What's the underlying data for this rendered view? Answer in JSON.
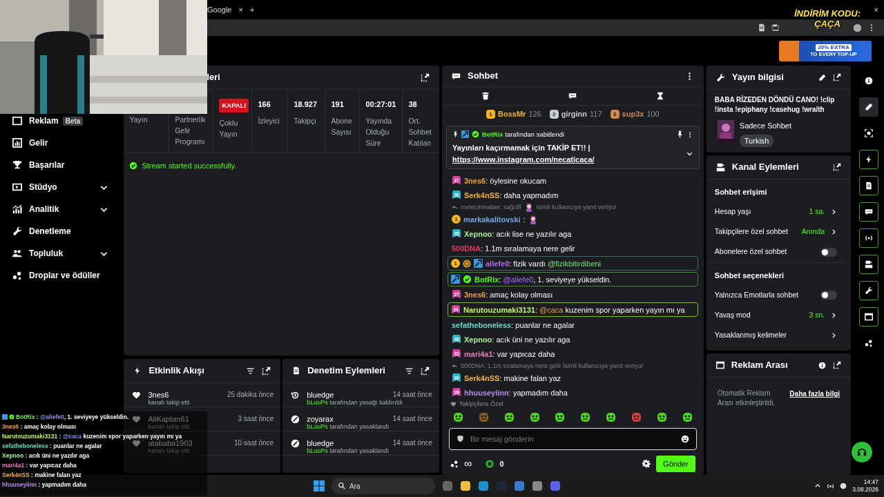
{
  "browser": {
    "tab_title": "Google",
    "tab_close": "×",
    "new_tab": "+",
    "window_close": "×"
  },
  "stream_overlay": {
    "promo_line1": "İNDİRİM KODU:",
    "promo_line2": "ÇAÇA"
  },
  "ad_banner": {
    "headline": "20% EXTRA",
    "subline": "TO EVERY TOP-UP"
  },
  "sidebar": {
    "items": [
      {
        "label": "Reklam",
        "badge": "Beta"
      },
      {
        "label": "Gelir"
      },
      {
        "label": "Başarılar"
      },
      {
        "label": "Stüdyo",
        "expanded": false
      },
      {
        "label": "Analitik",
        "expanded": false
      },
      {
        "label": "Denetleme"
      },
      {
        "label": "Topluluk",
        "expanded": false
      },
      {
        "label": "Droplar ve ödüller"
      }
    ]
  },
  "stats_panel": {
    "title": "leri",
    "stats": [
      {
        "label": "Yayın"
      },
      {
        "label": "Partnerlik Gelir Programı"
      },
      {
        "status": "KAPALI",
        "label": "Çoklu Yayın"
      },
      {
        "value": "166",
        "label": "İzleyici"
      },
      {
        "value": "18.927",
        "label": "Takipçi"
      },
      {
        "value": "191",
        "label": "Abone Sayısı"
      },
      {
        "value": "00:27:01",
        "label": "Yayında Olduğu Süre"
      },
      {
        "value": "38",
        "label": "Ort. Sohbet Katılan"
      }
    ],
    "notice": "Stream started successfully."
  },
  "activity_feed": {
    "title": "Etkinlik Akışı",
    "items": [
      {
        "user": "3nes6",
        "time": "25 dakika önce",
        "action": "kanalı takip etti"
      },
      {
        "user": "AliKaptan61",
        "time": "3 saat önce",
        "action": "kanalı takip etti"
      },
      {
        "user": "atababa1903",
        "time": "10 saat önce",
        "action": "kanalı takip etti"
      }
    ]
  },
  "mod_actions": {
    "title": "Denetim Eylemleri",
    "items": [
      {
        "kind": "unban",
        "user": "bluedge",
        "time": "14 saat önce",
        "moderator": "bLuuPs",
        "action": " tarafından yasağı kaldırıldı"
      },
      {
        "kind": "ban",
        "user": "zoyarax",
        "time": "14 saat önce",
        "moderator": "bLuuPs",
        "action": " tarafından yasaklandı"
      },
      {
        "kind": "ban",
        "user": "bluedge",
        "time": "14 saat önce",
        "moderator": "bLuuPs",
        "action": " tarafından yasaklandı"
      }
    ]
  },
  "chat": {
    "title": "Sohbet",
    "leaderboard": [
      {
        "rank": "1",
        "user": "BossMr",
        "score": "126",
        "color": "#f0b429"
      },
      {
        "rank": "2",
        "user": "girginn",
        "score": "117",
        "color": "#c9ccd1"
      },
      {
        "rank": "3",
        "user": "sup3x",
        "score": "100",
        "color": "#d08a4e"
      }
    ],
    "pinned": {
      "author": "BotRix",
      "note": " tarafından sabitlendi",
      "text": "Yayınları kaçırmamak için TAKİP ET!! |",
      "link": "https://www.instagram.com/necaticaca/"
    },
    "messages": [
      {
        "kind": "message",
        "badges": [
          {
            "kind": "sub",
            "text": "27",
            "color": "#d6409f"
          }
        ],
        "parts": [
          {
            "kind": "user",
            "text": "3nes6",
            "color": "#f0a040"
          },
          {
            "kind": "text",
            "text": ": öylesine okucam"
          }
        ]
      },
      {
        "kind": "message",
        "badges": [
          {
            "kind": "sub",
            "text": "30",
            "color": "#2bb5c8"
          }
        ],
        "parts": [
          {
            "kind": "user",
            "text": "Serk4nSS",
            "color": "#f5b041"
          },
          {
            "kind": "text",
            "text": ": daha yapmadım"
          }
        ]
      },
      {
        "kind": "reply",
        "parts": [
          {
            "kind": "text",
            "text": "metecimnaber: sağolll"
          },
          {
            "kind": "emote"
          },
          {
            "kind": "text",
            "text": "isimli kullanıcıya yanıt veriyor"
          }
        ]
      },
      {
        "kind": "message",
        "badges": [
          {
            "kind": "tier",
            "text": "1"
          }
        ],
        "parts": [
          {
            "kind": "user",
            "text": "markakalitovski",
            "color": "#7aa7e8"
          },
          {
            "kind": "text",
            "text": ":"
          },
          {
            "kind": "emote"
          }
        ]
      },
      {
        "kind": "message",
        "badges": [
          {
            "kind": "sub",
            "text": "35",
            "color": "#2bb5c8"
          }
        ],
        "parts": [
          {
            "kind": "user",
            "text": "Xepnoo",
            "color": "#a6f29a"
          },
          {
            "kind": "text",
            "text": ": acık lise ne yazılır aga"
          }
        ]
      },
      {
        "kind": "message",
        "parts": [
          {
            "kind": "user",
            "text": "500DNA",
            "color": "#e8365d"
          },
          {
            "kind": "text",
            "text": ": 1.1m sıralamaya nere gelir"
          }
        ]
      },
      {
        "kind": "message",
        "highlighted": true,
        "color": "#2f6f68",
        "badges": [
          {
            "kind": "tier",
            "text": "1"
          },
          {
            "kind": "coin"
          },
          {
            "kind": "moderator"
          }
        ],
        "parts": [
          {
            "kind": "user",
            "text": "aliefe0",
            "color": "#b06cf0"
          },
          {
            "kind": "text",
            "text": ": fizik vardı "
          },
          {
            "kind": "mention",
            "text": "@fizikbitirdibeni",
            "color": "#7be07b"
          }
        ]
      },
      {
        "kind": "message",
        "highlighted": true,
        "color": "#3f8f2f",
        "badges": [
          {
            "kind": "moderator"
          },
          {
            "kind": "verified"
          }
        ],
        "parts": [
          {
            "kind": "user",
            "text": "BotRix",
            "color": "#53fc18"
          },
          {
            "kind": "text",
            "text": ": "
          },
          {
            "kind": "mention",
            "text": "@aliefe0",
            "color": "#b06cf0"
          },
          {
            "kind": "text",
            "text": ", 1. seviyeye yükseldin."
          }
        ]
      },
      {
        "kind": "message",
        "badges": [
          {
            "kind": "sub",
            "text": "27",
            "color": "#d6409f"
          }
        ],
        "parts": [
          {
            "kind": "user",
            "text": "3nes6",
            "color": "#f0a040"
          },
          {
            "kind": "text",
            "text": ": amaç kolay olması"
          }
        ]
      },
      {
        "kind": "message",
        "highlighted": true,
        "color": "#6fbf3f",
        "badges": [
          {
            "kind": "sub",
            "text": "24",
            "color": "#d6409f"
          }
        ],
        "parts": [
          {
            "kind": "user",
            "text": "Narutouzumaki3131",
            "color": "#c8f56a"
          },
          {
            "kind": "text",
            "text": ": "
          },
          {
            "kind": "mention",
            "text": "@caca",
            "color": "#f0a040"
          },
          {
            "kind": "text",
            "text": " kuzenim spor yaparken yayın mı ya"
          }
        ]
      },
      {
        "kind": "message",
        "parts": [
          {
            "kind": "user",
            "text": "sefatheboneless",
            "color": "#6ad8c8"
          },
          {
            "kind": "text",
            "text": ": puanlar ne agalar"
          }
        ]
      },
      {
        "kind": "message",
        "badges": [
          {
            "kind": "sub",
            "text": "35",
            "color": "#2bb5c8"
          }
        ],
        "parts": [
          {
            "kind": "user",
            "text": "Xepnoo",
            "color": "#a6f29a"
          },
          {
            "kind": "text",
            "text": ": acık üni ne yazılır aga"
          }
        ]
      },
      {
        "kind": "message",
        "badges": [
          {
            "kind": "sub",
            "text": "22",
            "color": "#d6409f"
          }
        ],
        "parts": [
          {
            "kind": "user",
            "text": "mari4a1",
            "color": "#ea7fc0"
          },
          {
            "kind": "text",
            "text": ": var yapıcaz daha"
          }
        ]
      },
      {
        "kind": "reply",
        "parts": [
          {
            "kind": "text",
            "text": "500DNA: 1.1m sıralamaya nere gelir isimli kullanıcıya yanıt veriyor"
          }
        ]
      },
      {
        "kind": "message",
        "badges": [
          {
            "kind": "sub",
            "text": "30",
            "color": "#2bb5c8"
          }
        ],
        "parts": [
          {
            "kind": "user",
            "text": "Serk4nSS",
            "color": "#f5b041"
          },
          {
            "kind": "text",
            "text": ": makine falan yaz"
          }
        ]
      },
      {
        "kind": "message",
        "badges": [
          {
            "kind": "sub",
            "text": "29",
            "color": "#d6409f"
          }
        ],
        "parts": [
          {
            "kind": "user",
            "text": "hhuuseyiinn",
            "color": "#b98cf0"
          },
          {
            "kind": "text",
            "text": ": yapmadım daha"
          }
        ]
      }
    ],
    "followers_only_label": "Takipçilere Özel",
    "emotes": [
      {
        "color": "#53d42b"
      },
      {
        "color": "#8a5a2b"
      },
      {
        "color": "#53d42b"
      },
      {
        "color": "#53d42b"
      },
      {
        "color": "#53d42b"
      },
      {
        "color": "#53d42b"
      },
      {
        "color": "#53d42b"
      },
      {
        "color": "#d9423a"
      },
      {
        "color": "#53d42b"
      },
      {
        "color": "#53d42b"
      }
    ],
    "input": {
      "placeholder": "Bir mesaj gönderin"
    },
    "points": "∞",
    "coins": "0",
    "send_button": "Gönder"
  },
  "stream_info": {
    "title": "Yayın bilgisi",
    "stream_title": "BABA RİZEDEN DÖNDÜ CANO! !clip !insta !epiphany !casehug !wraith",
    "category": "Sadece Sohbet",
    "tag": "Turkish"
  },
  "channel_actions": {
    "title": "Kanal Eylemleri",
    "sections": [
      {
        "heading": "Sohbet erişimi",
        "rows": [
          {
            "kind": "link",
            "label": "Hesap yaşı",
            "value": "1 sa."
          },
          {
            "kind": "link",
            "label": "Takipçilere özel sohbet",
            "value": "Anında"
          },
          {
            "kind": "toggle",
            "label": "Abonelere özel sohbet",
            "on": false
          }
        ]
      },
      {
        "heading": "Sohbet seçenekleri",
        "rows": [
          {
            "kind": "toggle",
            "label": "Yalnızca Emotlarla sohbet",
            "on": false
          },
          {
            "kind": "link",
            "label": "Yavaş mod",
            "value": "3 sn."
          },
          {
            "kind": "link",
            "label": "Yasaklanmış kelimeler"
          }
        ]
      }
    ]
  },
  "ad_break": {
    "title": "Reklam Arası",
    "text": "Otomatik Reklam Arası etkinleştirildi.",
    "link": "Daha fazla bilgi"
  },
  "rail": {
    "items": [
      {
        "selected": false,
        "pinned": false
      },
      {
        "selected": true,
        "pinned": false
      },
      {
        "selected": false,
        "pinned": false
      },
      {
        "selected": false,
        "pinned": true
      },
      {
        "selected": false,
        "pinned": true
      },
      {
        "selected": false,
        "pinned": true
      },
      {
        "selected": false,
        "pinned": true
      },
      {
        "selected": false,
        "pinned": true
      },
      {
        "selected": false,
        "pinned": true
      },
      {
        "selected": false,
        "pinned": true
      },
      {
        "selected": false,
        "pinned": false
      }
    ]
  },
  "overlay_chat": [
    {
      "badges": true,
      "parts": [
        {
          "text": "BotRix",
          "color": "#7ee05a"
        },
        {
          "text": " : "
        },
        {
          "text": "@aliefe0",
          "color": "#8d8df0"
        },
        {
          "text": ", 1. seviyeye yükseldin."
        }
      ]
    },
    {
      "badges": false,
      "parts": [
        {
          "text": "3nes6",
          "color": "#f0a040"
        },
        {
          "text": " : amaç kolay olması"
        }
      ]
    },
    {
      "badges": false,
      "parts": [
        {
          "text": "Narutouzumaki3131",
          "color": "#c8f56a"
        },
        {
          "text": " : "
        },
        {
          "text": "@caca",
          "color": "#8d8df0"
        },
        {
          "text": " kuzenim spor yaparken yayın mı ya"
        }
      ]
    },
    {
      "badges": false,
      "parts": [
        {
          "text": "sefatheboneless",
          "color": "#6ad8c8"
        },
        {
          "text": " : puanlar ne agalar"
        }
      ]
    },
    {
      "badges": false,
      "parts": [
        {
          "text": "Xepnoo",
          "color": "#a6f29a"
        },
        {
          "text": " : acık üni ne yazılır aga"
        }
      ]
    },
    {
      "badges": false,
      "parts": [
        {
          "text": "mari4a1",
          "color": "#ea7fc0"
        },
        {
          "text": " : var yapıcaz daha"
        }
      ]
    },
    {
      "badges": false,
      "parts": [
        {
          "text": "Serk4nSS",
          "color": "#f5b041"
        },
        {
          "text": " : makine falan yaz"
        }
      ]
    },
    {
      "badges": false,
      "parts": [
        {
          "text": "hhuuseyiinn",
          "color": "#b98cf0"
        },
        {
          "text": " : yapmadım daha"
        }
      ]
    }
  ],
  "taskbar": {
    "search_placeholder": "Ara",
    "time": "14:47",
    "date": "3.08.2026"
  }
}
